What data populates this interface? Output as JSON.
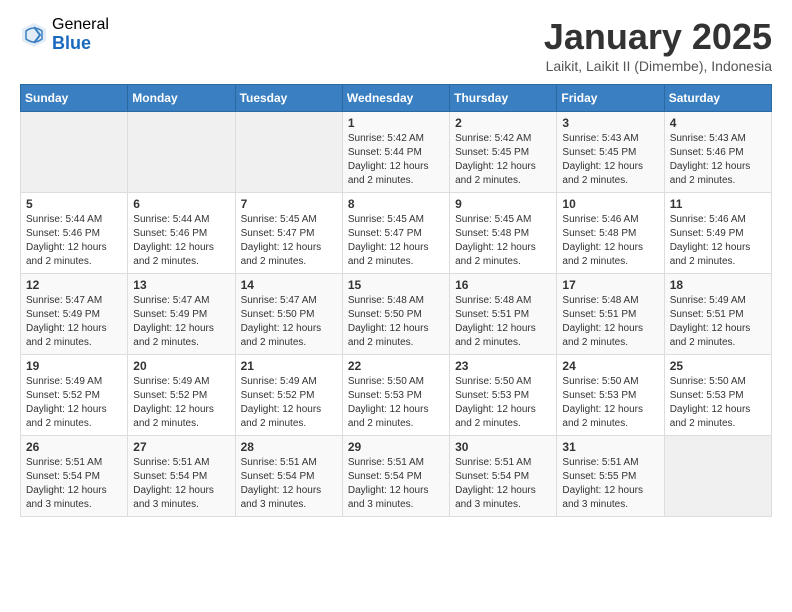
{
  "header": {
    "logo_general": "General",
    "logo_blue": "Blue",
    "month_title": "January 2025",
    "location": "Laikit, Laikit II (Dimembe), Indonesia"
  },
  "days_of_week": [
    "Sunday",
    "Monday",
    "Tuesday",
    "Wednesday",
    "Thursday",
    "Friday",
    "Saturday"
  ],
  "weeks": [
    {
      "days": [
        {
          "number": "",
          "content": ""
        },
        {
          "number": "",
          "content": ""
        },
        {
          "number": "",
          "content": ""
        },
        {
          "number": "1",
          "content": "Sunrise: 5:42 AM\nSunset: 5:44 PM\nDaylight: 12 hours and 2 minutes."
        },
        {
          "number": "2",
          "content": "Sunrise: 5:42 AM\nSunset: 5:45 PM\nDaylight: 12 hours and 2 minutes."
        },
        {
          "number": "3",
          "content": "Sunrise: 5:43 AM\nSunset: 5:45 PM\nDaylight: 12 hours and 2 minutes."
        },
        {
          "number": "4",
          "content": "Sunrise: 5:43 AM\nSunset: 5:46 PM\nDaylight: 12 hours and 2 minutes."
        }
      ]
    },
    {
      "days": [
        {
          "number": "5",
          "content": "Sunrise: 5:44 AM\nSunset: 5:46 PM\nDaylight: 12 hours and 2 minutes."
        },
        {
          "number": "6",
          "content": "Sunrise: 5:44 AM\nSunset: 5:46 PM\nDaylight: 12 hours and 2 minutes."
        },
        {
          "number": "7",
          "content": "Sunrise: 5:45 AM\nSunset: 5:47 PM\nDaylight: 12 hours and 2 minutes."
        },
        {
          "number": "8",
          "content": "Sunrise: 5:45 AM\nSunset: 5:47 PM\nDaylight: 12 hours and 2 minutes."
        },
        {
          "number": "9",
          "content": "Sunrise: 5:45 AM\nSunset: 5:48 PM\nDaylight: 12 hours and 2 minutes."
        },
        {
          "number": "10",
          "content": "Sunrise: 5:46 AM\nSunset: 5:48 PM\nDaylight: 12 hours and 2 minutes."
        },
        {
          "number": "11",
          "content": "Sunrise: 5:46 AM\nSunset: 5:49 PM\nDaylight: 12 hours and 2 minutes."
        }
      ]
    },
    {
      "days": [
        {
          "number": "12",
          "content": "Sunrise: 5:47 AM\nSunset: 5:49 PM\nDaylight: 12 hours and 2 minutes."
        },
        {
          "number": "13",
          "content": "Sunrise: 5:47 AM\nSunset: 5:49 PM\nDaylight: 12 hours and 2 minutes."
        },
        {
          "number": "14",
          "content": "Sunrise: 5:47 AM\nSunset: 5:50 PM\nDaylight: 12 hours and 2 minutes."
        },
        {
          "number": "15",
          "content": "Sunrise: 5:48 AM\nSunset: 5:50 PM\nDaylight: 12 hours and 2 minutes."
        },
        {
          "number": "16",
          "content": "Sunrise: 5:48 AM\nSunset: 5:51 PM\nDaylight: 12 hours and 2 minutes."
        },
        {
          "number": "17",
          "content": "Sunrise: 5:48 AM\nSunset: 5:51 PM\nDaylight: 12 hours and 2 minutes."
        },
        {
          "number": "18",
          "content": "Sunrise: 5:49 AM\nSunset: 5:51 PM\nDaylight: 12 hours and 2 minutes."
        }
      ]
    },
    {
      "days": [
        {
          "number": "19",
          "content": "Sunrise: 5:49 AM\nSunset: 5:52 PM\nDaylight: 12 hours and 2 minutes."
        },
        {
          "number": "20",
          "content": "Sunrise: 5:49 AM\nSunset: 5:52 PM\nDaylight: 12 hours and 2 minutes."
        },
        {
          "number": "21",
          "content": "Sunrise: 5:49 AM\nSunset: 5:52 PM\nDaylight: 12 hours and 2 minutes."
        },
        {
          "number": "22",
          "content": "Sunrise: 5:50 AM\nSunset: 5:53 PM\nDaylight: 12 hours and 2 minutes."
        },
        {
          "number": "23",
          "content": "Sunrise: 5:50 AM\nSunset: 5:53 PM\nDaylight: 12 hours and 2 minutes."
        },
        {
          "number": "24",
          "content": "Sunrise: 5:50 AM\nSunset: 5:53 PM\nDaylight: 12 hours and 2 minutes."
        },
        {
          "number": "25",
          "content": "Sunrise: 5:50 AM\nSunset: 5:53 PM\nDaylight: 12 hours and 2 minutes."
        }
      ]
    },
    {
      "days": [
        {
          "number": "26",
          "content": "Sunrise: 5:51 AM\nSunset: 5:54 PM\nDaylight: 12 hours and 3 minutes."
        },
        {
          "number": "27",
          "content": "Sunrise: 5:51 AM\nSunset: 5:54 PM\nDaylight: 12 hours and 3 minutes."
        },
        {
          "number": "28",
          "content": "Sunrise: 5:51 AM\nSunset: 5:54 PM\nDaylight: 12 hours and 3 minutes."
        },
        {
          "number": "29",
          "content": "Sunrise: 5:51 AM\nSunset: 5:54 PM\nDaylight: 12 hours and 3 minutes."
        },
        {
          "number": "30",
          "content": "Sunrise: 5:51 AM\nSunset: 5:54 PM\nDaylight: 12 hours and 3 minutes."
        },
        {
          "number": "31",
          "content": "Sunrise: 5:51 AM\nSunset: 5:55 PM\nDaylight: 12 hours and 3 minutes."
        },
        {
          "number": "",
          "content": ""
        }
      ]
    }
  ]
}
